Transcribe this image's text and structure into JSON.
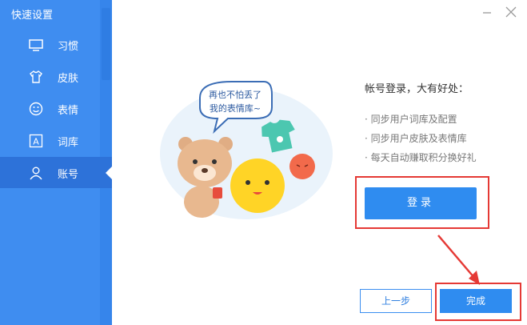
{
  "sidebar": {
    "title": "快速设置",
    "items": [
      {
        "label": "习惯",
        "icon": "monitor-icon",
        "active": false
      },
      {
        "label": "皮肤",
        "icon": "tshirt-icon",
        "active": false
      },
      {
        "label": "表情",
        "icon": "smiley-icon",
        "active": false
      },
      {
        "label": "词库",
        "icon": "letter-a-icon",
        "active": false
      },
      {
        "label": "账号",
        "icon": "user-icon",
        "active": true
      }
    ]
  },
  "illustration": {
    "speech_line1": "再也不怕丢了",
    "speech_line2": "我的表情库~"
  },
  "main": {
    "benefit_title": "帐号登录，大有好处：",
    "benefits": [
      "· 同步用户词库及配置",
      "· 同步用户皮肤及表情库",
      "· 每天自动赚取积分换好礼"
    ],
    "login_label": "登录",
    "prev_label": "上一步",
    "done_label": "完成"
  },
  "colors": {
    "accent": "#2f8cf0",
    "sidebar": "#3f8df0",
    "highlight": "#e53935"
  }
}
